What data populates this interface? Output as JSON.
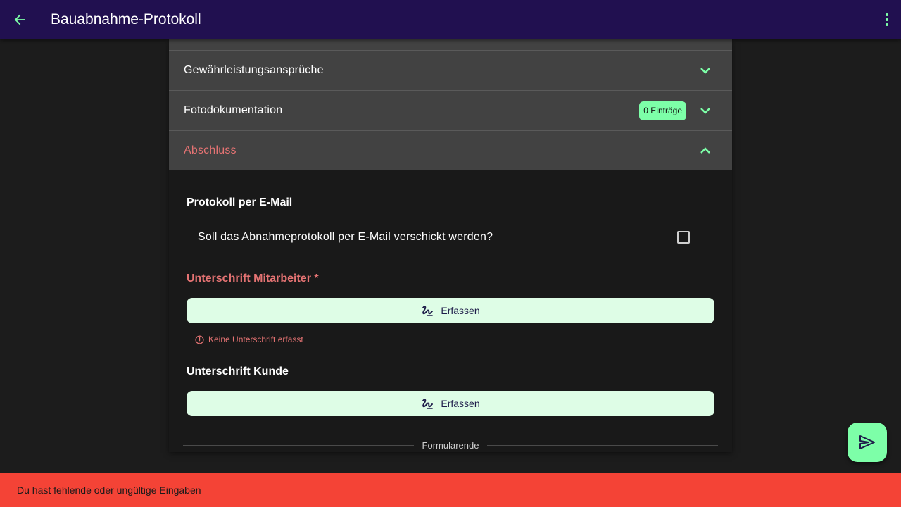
{
  "appbar": {
    "title": "Bauabnahme-Protokoll",
    "back_icon": "arrow-left-icon",
    "menu_icon": "more-vert-icon"
  },
  "sections": [
    {
      "label": "Gewährleistungsansprüche",
      "expanded": false
    },
    {
      "label": "Fotodokumentation",
      "expanded": false,
      "badge": "0 Einträge"
    },
    {
      "label": "Abschluss",
      "expanded": true,
      "has_error": true
    }
  ],
  "abschluss": {
    "email_heading": "Protokoll per E-Mail",
    "email_question": "Soll das Abnahmeprotokoll per E-Mail verschickt werden?",
    "email_checked": false,
    "sig_employee_heading": "Unterschrift Mitarbeiter *",
    "sig_employee_button": "Erfassen",
    "sig_employee_error": "Keine Unterschrift erfasst",
    "sig_customer_heading": "Unterschrift Kunde",
    "sig_customer_button": "Erfassen",
    "form_end": "Formularende"
  },
  "fab": {
    "icon": "send-icon"
  },
  "snackbar": {
    "message": "Du hast fehlende oder ungültige Eingaben"
  },
  "colors": {
    "appbar": "#211050",
    "accent": "#7dffa8",
    "error": "#e57373",
    "snackbar": "#f44336",
    "signature_button": "#defde6"
  }
}
